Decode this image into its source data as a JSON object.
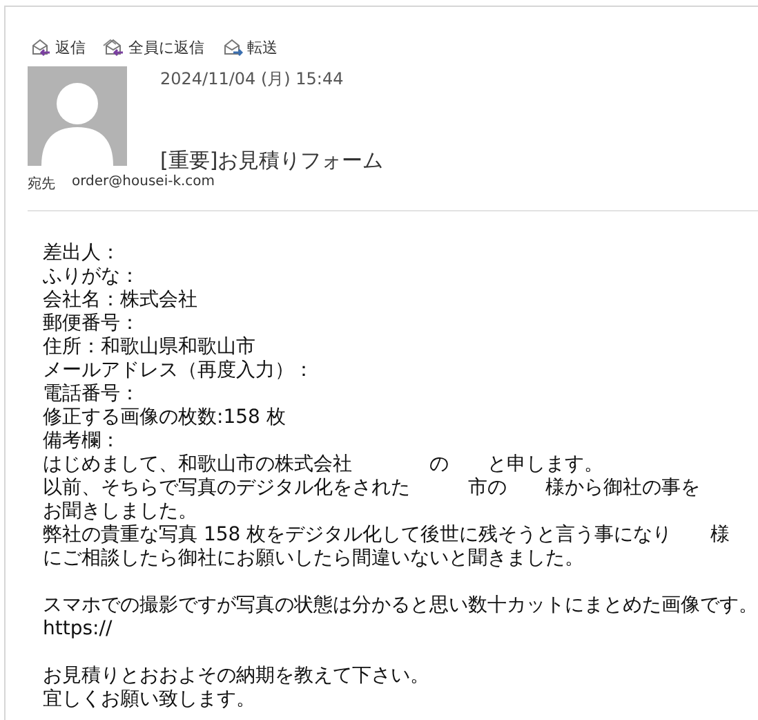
{
  "toolbar": [
    {
      "kind": "reply",
      "label": "返信"
    },
    {
      "kind": "reply_all",
      "label": "全員に返信"
    },
    {
      "kind": "forward",
      "label": "転送"
    }
  ],
  "header": {
    "date": "2024/11/04 (月) 15:44",
    "subject": "[重要]お見積りフォーム",
    "to_label": "宛先",
    "to": "order@housei-k.com"
  },
  "body": [
    [
      "差出人：",
      "ふりがな：",
      "会社名：株式会社",
      "郵便番号：",
      "住所：和歌山県和歌山市",
      "メールアドレス（再度入力）：",
      "電話番号：",
      "修正する画像の枚数:158 枚",
      "備考欄：",
      "はじめまして、和歌山市の株式会社　　　　の　　と申します。",
      "以前、そちらで写真のデジタル化をされた　　　市の　　様から御社の事を",
      "お聞きしました。",
      "弊社の貴重な写真 158 枚をデジタル化して後世に残そうと言う事になり　　様",
      "にご相談したら御社にお願いしたら間違いないと聞きました。"
    ],
    [
      "スマホでの撮影ですが写真の状態は分かると思い数十カットにまとめた画像です。",
      "https://"
    ],
    [
      "お見積りとおおよその納期を教えて下さい。",
      "宜しくお願い致します。"
    ]
  ]
}
